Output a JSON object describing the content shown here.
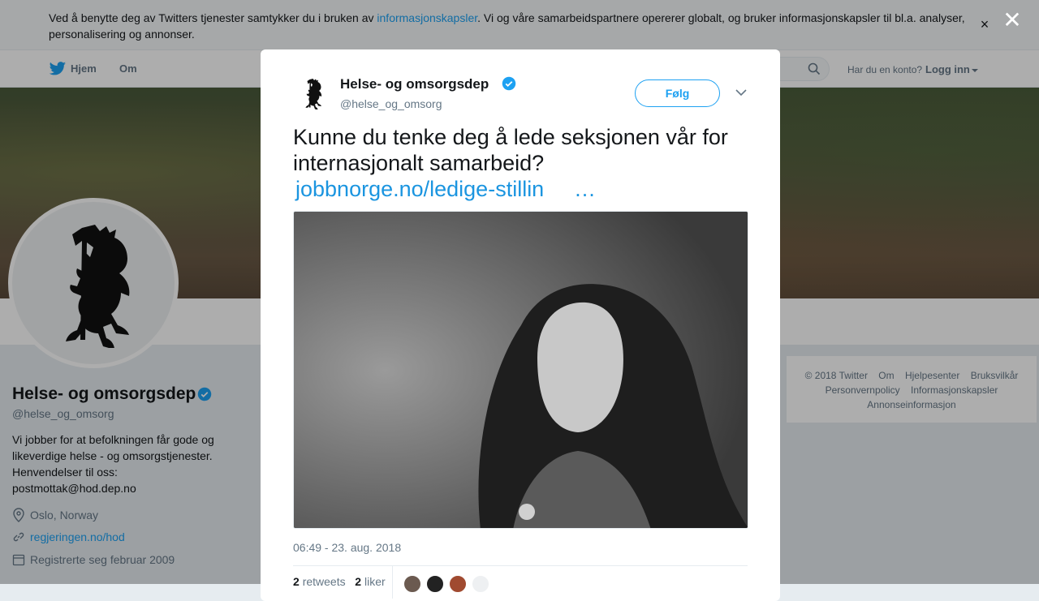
{
  "cookie_banner": {
    "text_before": "Ved å benytte deg av Twitters tjenester samtykker du i bruken av ",
    "link": "informasjonskapsler",
    "text_after": ". Vi og våre samarbeidspartnere opererer globalt, og bruker informasjonskapsler til bl.a. analyser, personalisering og annonser.",
    "close_glyph": "×"
  },
  "nav": {
    "home": "Hjem",
    "about": "Om",
    "login_question": "Har du en konto?",
    "login_link": "Logg inn"
  },
  "profile": {
    "name": "Helse- og omsorgsdep",
    "handle": "@helse_og_omsorg",
    "bio": "Vi jobber for at befolkningen får gode og likeverdige helse - og omsorgstjenester. Henvendelser til oss: postmottak@hod.dep.no",
    "location": "Oslo, Norway",
    "website": "regjeringen.no/hod",
    "joined": "Registrerte seg februar 2009"
  },
  "footer": {
    "items": [
      "© 2018 Twitter",
      "Om",
      "Hjelpesenter",
      "Bruksvilkår",
      "Personvernpolicy",
      "Informasjonskapsler",
      "Annonseinformasjon"
    ]
  },
  "overlay": {
    "close_glyph": "✕"
  },
  "tweet": {
    "author_name": "Helse- og omsorgsdep",
    "author_handle": "@helse_og_omsorg",
    "follow_label": "Følg",
    "text": "Kunne du tenke deg å lede seksjonen vår for internasjonalt samarbeid?",
    "link": "jobbnorge.no/ledige-stillin",
    "ellipsis": "…",
    "timestamp": "06:49 - 23. aug. 2018",
    "retweets_count": "2",
    "retweets_label": "retweets",
    "likes_count": "2",
    "likes_label": "liker"
  },
  "colors": {
    "accent": "#1da1f2",
    "verified": "#1da1f2",
    "muted": "#657786"
  }
}
